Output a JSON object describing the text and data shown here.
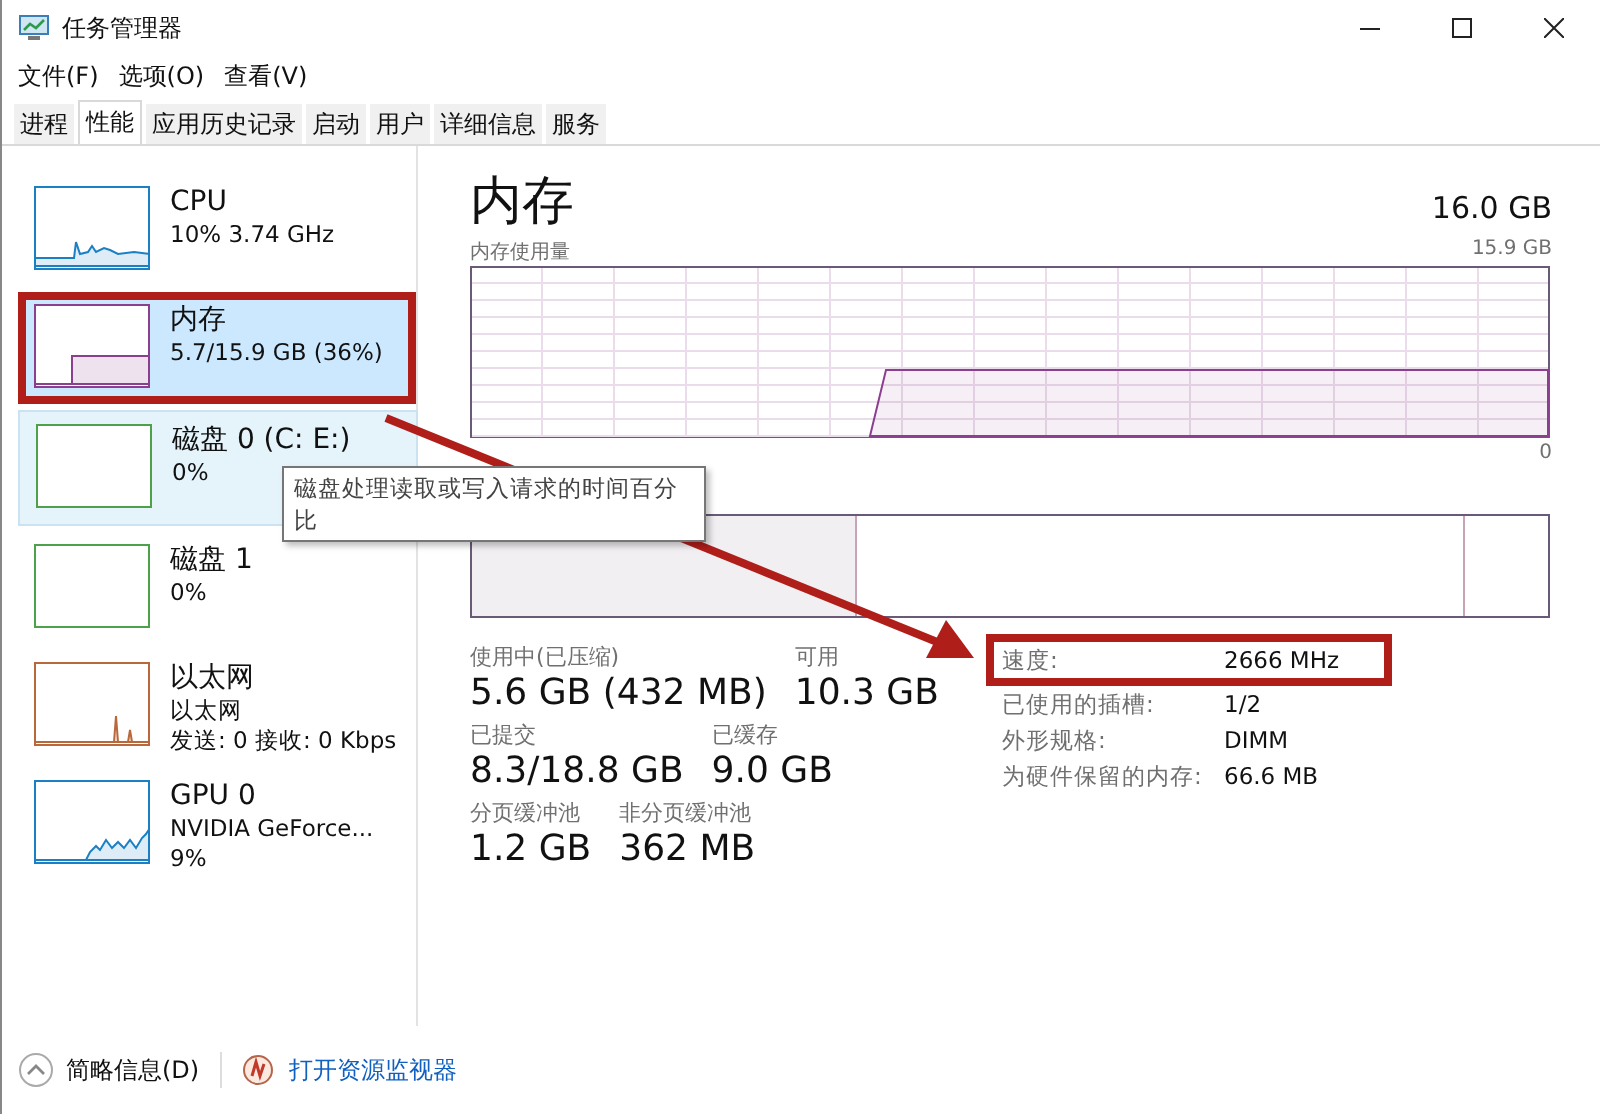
{
  "window": {
    "title": "任务管理器"
  },
  "menu": [
    "文件(F)",
    "选项(O)",
    "查看(V)"
  ],
  "tabs": [
    {
      "label": "进程",
      "selected": false
    },
    {
      "label": "性能",
      "selected": true
    },
    {
      "label": "应用历史记录",
      "selected": false
    },
    {
      "label": "启动",
      "selected": false
    },
    {
      "label": "用户",
      "selected": false
    },
    {
      "label": "详细信息",
      "selected": false
    },
    {
      "label": "服务",
      "selected": false
    }
  ],
  "sidebar": {
    "items": [
      {
        "kind": "cpu",
        "name": "CPU",
        "lines": [
          "10% 3.74 GHz"
        ],
        "selected": false,
        "hovered": false,
        "annotated": false
      },
      {
        "kind": "memory",
        "name": "内存",
        "lines": [
          "5.7/15.9 GB (36%)"
        ],
        "selected": true,
        "hovered": false,
        "annotated": true
      },
      {
        "kind": "disk",
        "name": "磁盘 0 (C: E:)",
        "lines": [
          "0%"
        ],
        "selected": false,
        "hovered": true,
        "annotated": false
      },
      {
        "kind": "disk",
        "name": "磁盘 1",
        "lines": [
          "0%"
        ],
        "selected": false,
        "hovered": false,
        "annotated": false
      },
      {
        "kind": "ethernet",
        "name": "以太网",
        "lines": [
          "以太网",
          "发送: 0 接收: 0 Kbps"
        ],
        "selected": false,
        "hovered": false,
        "annotated": false
      },
      {
        "kind": "gpu",
        "name": "GPU 0",
        "lines": [
          "NVIDIA GeForce...",
          "9%"
        ],
        "selected": false,
        "hovered": false,
        "annotated": false
      }
    ]
  },
  "tooltip": {
    "text": "磁盘处理读取或写入请求的时间百分比"
  },
  "main": {
    "title": "内存",
    "capacity": "16.0 GB",
    "chart": {
      "label": "内存使用量",
      "max": "15.9 GB",
      "min": "0"
    },
    "stats": [
      [
        {
          "label": "使用中(已压缩)",
          "value": "5.6 GB (432 MB)"
        },
        {
          "label": "可用",
          "value": "10.3 GB"
        }
      ],
      [
        {
          "label": "已提交",
          "value": "8.3/18.8 GB"
        },
        {
          "label": "已缓存",
          "value": "9.0 GB"
        }
      ],
      [
        {
          "label": "分页缓冲池",
          "value": "1.2 GB"
        },
        {
          "label": "非分页缓冲池",
          "value": "362 MB"
        }
      ]
    ],
    "specs": [
      {
        "label": "速度:",
        "value": "2666 MHz",
        "annotated": true
      },
      {
        "label": "已使用的插槽:",
        "value": "1/2",
        "annotated": false
      },
      {
        "label": "外形规格:",
        "value": "DIMM",
        "annotated": false
      },
      {
        "label": "为硬件保留的内存:",
        "value": "66.6 MB",
        "annotated": false
      }
    ]
  },
  "footer": {
    "details_button": "简略信息(D)",
    "monitor_link": "打开资源监视器"
  }
}
